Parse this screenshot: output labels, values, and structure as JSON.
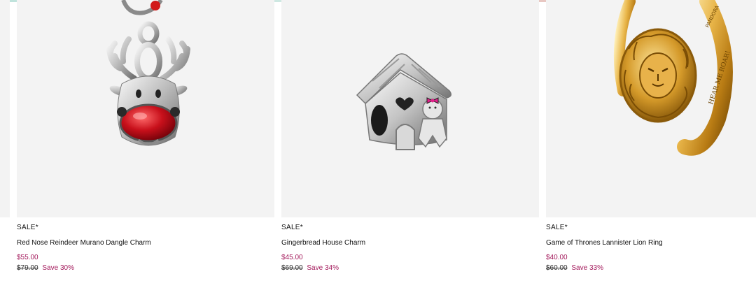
{
  "colors": {
    "tile_bg": "#f3f3f3",
    "sale_price": "#a3195b",
    "text": "#111111"
  },
  "products": [
    {
      "badge": "SALE*",
      "name": "Red Nose Reindeer Murano Dangle Charm",
      "price": "$55.00",
      "original_price": "$79.00",
      "save": "Save 30%",
      "image_icon": "reindeer-charm-image"
    },
    {
      "badge": "SALE*",
      "name": "Gingerbread House Charm",
      "price": "$45.00",
      "original_price": "$69.00",
      "save": "Save 34%",
      "image_icon": "gingerbread-house-charm-image"
    },
    {
      "badge": "SALE*",
      "name": "Game of Thrones Lannister Lion Ring",
      "price": "$40.00",
      "original_price": "$60.00",
      "save": "Save 33%",
      "image_icon": "lion-ring-image"
    }
  ]
}
